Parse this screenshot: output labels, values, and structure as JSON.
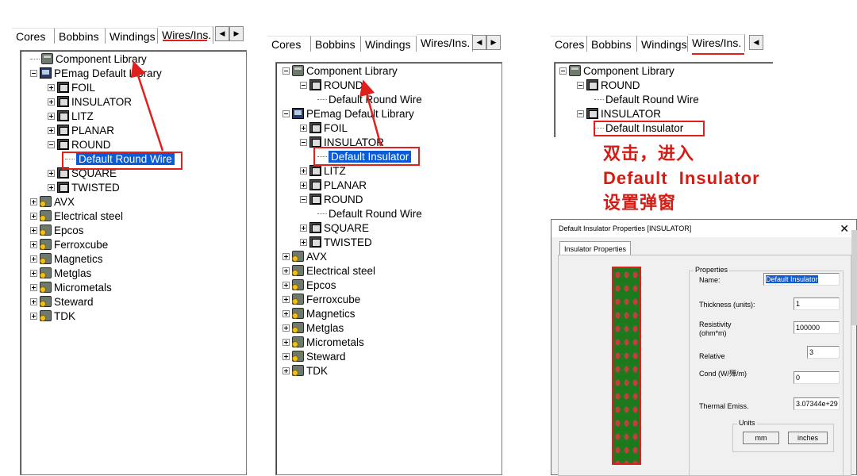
{
  "panel1": {
    "tabs": [
      "Cores",
      "Bobbins",
      "Windings",
      "Wires/Ins."
    ],
    "tree": [
      {
        "label": "Component Library",
        "depth": 0,
        "toggle": "none",
        "icon": "library-icon"
      },
      {
        "label": "PEmag Default Library",
        "depth": 0,
        "toggle": "minus",
        "icon": "computer-icon"
      },
      {
        "label": "FOIL",
        "depth": 1,
        "toggle": "plus",
        "icon": "folder-icon"
      },
      {
        "label": "INSULATOR",
        "depth": 1,
        "toggle": "plus",
        "icon": "folder-icon"
      },
      {
        "label": "LITZ",
        "depth": 1,
        "toggle": "plus",
        "icon": "folder-icon"
      },
      {
        "label": "PLANAR",
        "depth": 1,
        "toggle": "plus",
        "icon": "folder-icon"
      },
      {
        "label": "ROUND",
        "depth": 1,
        "toggle": "minus",
        "icon": "folder-icon"
      },
      {
        "label": "Default Round Wire",
        "depth": 2,
        "toggle": "leaf",
        "icon": "",
        "selected": true
      },
      {
        "label": "SQUARE",
        "depth": 1,
        "toggle": "plus",
        "icon": "folder-icon"
      },
      {
        "label": "TWISTED",
        "depth": 1,
        "toggle": "plus",
        "icon": "folder-icon"
      },
      {
        "label": "AVX",
        "depth": 0,
        "toggle": "plus",
        "icon": "vendor-library-icon"
      },
      {
        "label": "Electrical steel",
        "depth": 0,
        "toggle": "plus",
        "icon": "vendor-library-icon"
      },
      {
        "label": "Epcos",
        "depth": 0,
        "toggle": "plus",
        "icon": "vendor-library-icon"
      },
      {
        "label": "Ferroxcube",
        "depth": 0,
        "toggle": "plus",
        "icon": "vendor-library-icon"
      },
      {
        "label": "Magnetics",
        "depth": 0,
        "toggle": "plus",
        "icon": "vendor-library-icon"
      },
      {
        "label": "Metglas",
        "depth": 0,
        "toggle": "plus",
        "icon": "vendor-library-icon"
      },
      {
        "label": "Micrometals",
        "depth": 0,
        "toggle": "plus",
        "icon": "vendor-library-icon"
      },
      {
        "label": "Steward",
        "depth": 0,
        "toggle": "plus",
        "icon": "vendor-library-icon"
      },
      {
        "label": "TDK",
        "depth": 0,
        "toggle": "plus",
        "icon": "vendor-library-icon"
      }
    ]
  },
  "panel2": {
    "tabs": [
      "Cores",
      "Bobbins",
      "Windings",
      "Wires/Ins."
    ],
    "tree": [
      {
        "label": "Component Library",
        "depth": 0,
        "toggle": "minus",
        "icon": "library-icon"
      },
      {
        "label": "ROUND",
        "depth": 1,
        "toggle": "minus",
        "icon": "folder-icon"
      },
      {
        "label": "Default Round Wire",
        "depth": 2,
        "toggle": "leaf",
        "icon": ""
      },
      {
        "label": "PEmag Default Library",
        "depth": 0,
        "toggle": "minus",
        "icon": "computer-icon"
      },
      {
        "label": "FOIL",
        "depth": 1,
        "toggle": "plus",
        "icon": "folder-icon"
      },
      {
        "label": "INSULATOR",
        "depth": 1,
        "toggle": "minus",
        "icon": "folder-icon"
      },
      {
        "label": "Default Insulator",
        "depth": 2,
        "toggle": "leaf",
        "icon": "",
        "selected": true
      },
      {
        "label": "LITZ",
        "depth": 1,
        "toggle": "plus",
        "icon": "folder-icon"
      },
      {
        "label": "PLANAR",
        "depth": 1,
        "toggle": "plus",
        "icon": "folder-icon"
      },
      {
        "label": "ROUND",
        "depth": 1,
        "toggle": "minus",
        "icon": "folder-icon"
      },
      {
        "label": "Default Round Wire",
        "depth": 2,
        "toggle": "leaf",
        "icon": ""
      },
      {
        "label": "SQUARE",
        "depth": 1,
        "toggle": "plus",
        "icon": "folder-icon"
      },
      {
        "label": "TWISTED",
        "depth": 1,
        "toggle": "plus",
        "icon": "folder-icon"
      },
      {
        "label": "AVX",
        "depth": 0,
        "toggle": "plus",
        "icon": "vendor-library-icon"
      },
      {
        "label": "Electrical steel",
        "depth": 0,
        "toggle": "plus",
        "icon": "vendor-library-icon"
      },
      {
        "label": "Epcos",
        "depth": 0,
        "toggle": "plus",
        "icon": "vendor-library-icon"
      },
      {
        "label": "Ferroxcube",
        "depth": 0,
        "toggle": "plus",
        "icon": "vendor-library-icon"
      },
      {
        "label": "Magnetics",
        "depth": 0,
        "toggle": "plus",
        "icon": "vendor-library-icon"
      },
      {
        "label": "Metglas",
        "depth": 0,
        "toggle": "plus",
        "icon": "vendor-library-icon"
      },
      {
        "label": "Micrometals",
        "depth": 0,
        "toggle": "plus",
        "icon": "vendor-library-icon"
      },
      {
        "label": "Steward",
        "depth": 0,
        "toggle": "plus",
        "icon": "vendor-library-icon"
      },
      {
        "label": "TDK",
        "depth": 0,
        "toggle": "plus",
        "icon": "vendor-library-icon"
      }
    ]
  },
  "panel3": {
    "tabs": [
      "Cores",
      "Bobbins",
      "Windings",
      "Wires/Ins."
    ],
    "tree": [
      {
        "label": "Component Library",
        "depth": 0,
        "toggle": "minus",
        "icon": "library-icon"
      },
      {
        "label": "ROUND",
        "depth": 1,
        "toggle": "minus",
        "icon": "folder-icon"
      },
      {
        "label": "Default Round Wire",
        "depth": 2,
        "toggle": "leaf",
        "icon": ""
      },
      {
        "label": "INSULATOR",
        "depth": 1,
        "toggle": "minus",
        "icon": "folder-icon"
      },
      {
        "label": "Default Insulator",
        "depth": 2,
        "toggle": "leaf",
        "icon": ""
      }
    ]
  },
  "annotation": {
    "line1": "双击，进入",
    "line2": "Default  Insulator",
    "line3": "设置弹窗",
    "color": "#d41c14"
  },
  "dialog": {
    "title": "Default Insulator Properties [INSULATOR]",
    "close": "✕",
    "tab": "Insulator Properties",
    "group_label": "Properties",
    "units_label": "Units",
    "fields": [
      {
        "label": "Name:",
        "value": "Default Insulator"
      },
      {
        "label": "Thickness (units):",
        "value": "1"
      },
      {
        "label": "Resistivity\n(ohm*m)",
        "value": "100000"
      },
      {
        "label": "Relative",
        "value": "3"
      },
      {
        "label": "Cond (W/殫/m)",
        "value": "0"
      },
      {
        "label": "Thermal Emiss.",
        "value": "3.07344e+29"
      }
    ],
    "units_buttons": [
      "mm",
      "inches"
    ],
    "insulator_color": "#1c7a1c"
  }
}
